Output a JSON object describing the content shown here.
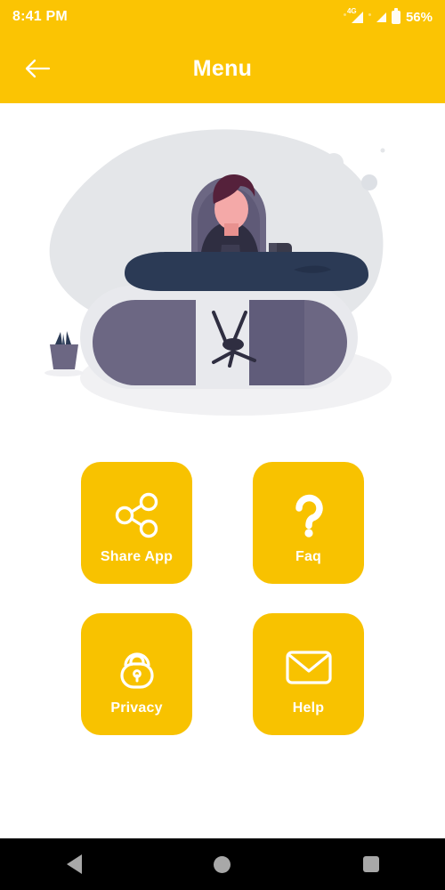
{
  "status_bar": {
    "time": "8:41 PM",
    "network_type": "4G",
    "battery_percent": "56%",
    "icons": [
      "signal-icon",
      "network-4g-icon",
      "signal-icon",
      "battery-icon"
    ]
  },
  "app_bar": {
    "title": "Menu",
    "back_icon": "arrow-left-icon"
  },
  "illustration": {
    "name": "person-at-desk-illustration",
    "colors": {
      "blob": "#E4E6E9",
      "desk_top": "#2B3A55",
      "desk_panel": "#6C6783",
      "desk_edge": "#E8E9ED",
      "skin": "#F4A9A8",
      "hair": "#55213B",
      "shirt": "#2F2E41",
      "chair": "#6C6783"
    }
  },
  "menu": {
    "items": [
      {
        "id": "share-app",
        "label": "Share App",
        "icon": "share-icon"
      },
      {
        "id": "faq",
        "label": "Faq",
        "icon": "question-mark-icon"
      },
      {
        "id": "privacy",
        "label": "Privacy",
        "icon": "lock-icon"
      },
      {
        "id": "help",
        "label": "Help",
        "icon": "envelope-icon"
      }
    ]
  },
  "nav_bar": {
    "back": "back-triangle-icon",
    "home": "home-circle-icon",
    "recents": "recents-square-icon"
  },
  "theme": {
    "primary": "#FBC403",
    "card": "#F8C200",
    "on_primary": "#FFFFFF",
    "nav_background": "#000000",
    "nav_icon": "#A8A8A8"
  }
}
